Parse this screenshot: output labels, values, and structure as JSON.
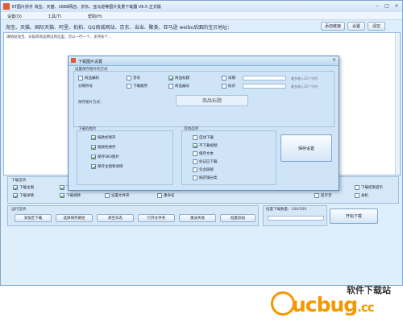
{
  "window": {
    "title": "KT图片抓手 淘宝、天猫、1688网店、京东、亚马逊等图片批量下载器 V6.5 正式版",
    "controls": [
      "–",
      "□",
      "×"
    ]
  },
  "menu": [
    "设置(O)",
    "工具(T)",
    "帮助(H)"
  ],
  "url_bar": {
    "text": "淘宝、天猫、国际天猫、阿里、拍拍、QQ商城网站、京东、当当、聚美、亚马逊 weibo后面的宝贝地址：",
    "buttons": [
      "添加链接",
      "设置",
      "清空"
    ]
  },
  "log": {
    "text": "请粘贴淘宝、天猫等商品网址到这里，可以一行一个，支持多个..."
  },
  "dialog": {
    "title": "下载图片设置",
    "close": "×",
    "naming_group": "设置保存图片的方式",
    "naming_options": [
      {
        "label": "商品编码",
        "checked": false
      },
      {
        "label": "货号",
        "checked": false
      },
      {
        "label": "商品标题",
        "checked": true
      },
      {
        "label": "日期",
        "checked": false
      }
    ],
    "naming_options_2": [
      {
        "label": "分隔符号",
        "checked": false
      },
      {
        "label": "下载顺序",
        "checked": false
      },
      {
        "label": "商品编号",
        "checked": false
      },
      {
        "label": "标识",
        "checked": false
      }
    ],
    "hint": "最多输入20个字符",
    "preview_label": "保存图片方式：",
    "preview_value": "商品标题",
    "content_group": "下载的图片",
    "content_options": [
      {
        "label": "按款式保存",
        "checked": true
      },
      {
        "label": "按颜色保存",
        "checked": true
      },
      {
        "label": "保存SKU图片",
        "checked": true
      },
      {
        "label": "保存主图和详情",
        "checked": true
      }
    ],
    "other_group": "其他选项",
    "other_options": [
      {
        "label": "自动下载",
        "checked": false
      },
      {
        "label": "不下载视频",
        "checked": true
      },
      {
        "label": "保存文本",
        "checked": false
      },
      {
        "label": "标记已下载",
        "checked": false
      },
      {
        "label": "包含链接",
        "checked": false
      },
      {
        "label": "按店铺分类",
        "checked": false
      }
    ],
    "apply_button": "保存设置"
  },
  "download_panel": {
    "title": "下载选项",
    "options": [
      {
        "label": "下载主图",
        "checked": true
      },
      {
        "label": "下载SKU",
        "checked": true
      },
      {
        "label": "下载详情",
        "checked": true
      },
      {
        "label": "下载视频",
        "checked": true
      }
    ],
    "options_2": [
      {
        "label": "下载颜色",
        "checked": true
      },
      {
        "label": "下载其他",
        "checked": true
      },
      {
        "label": "设置文件夹",
        "checked": false
      },
      {
        "label": "重命名",
        "checked": false
      }
    ],
    "right_options": [
      {
        "label": "下载中途停止",
        "checked": true
      },
      {
        "label": "下载结束提示",
        "checked": false
      },
      {
        "label": "提示音",
        "checked": false
      },
      {
        "label": "关机",
        "checked": false
      }
    ]
  },
  "quick_panel": {
    "title": "运行选项",
    "buttons": [
      "添加至下载",
      "选择保存路径",
      "清空日志",
      "打开文件夹",
      "重试失败",
      "批量添加"
    ]
  },
  "batch_panel": {
    "title": "批量下载数量：100/500",
    "start_button": "开始下载"
  },
  "watermark": {
    "cn": "软件下载站",
    "logo_main": "ucbug",
    "logo_tld": ".cc"
  }
}
